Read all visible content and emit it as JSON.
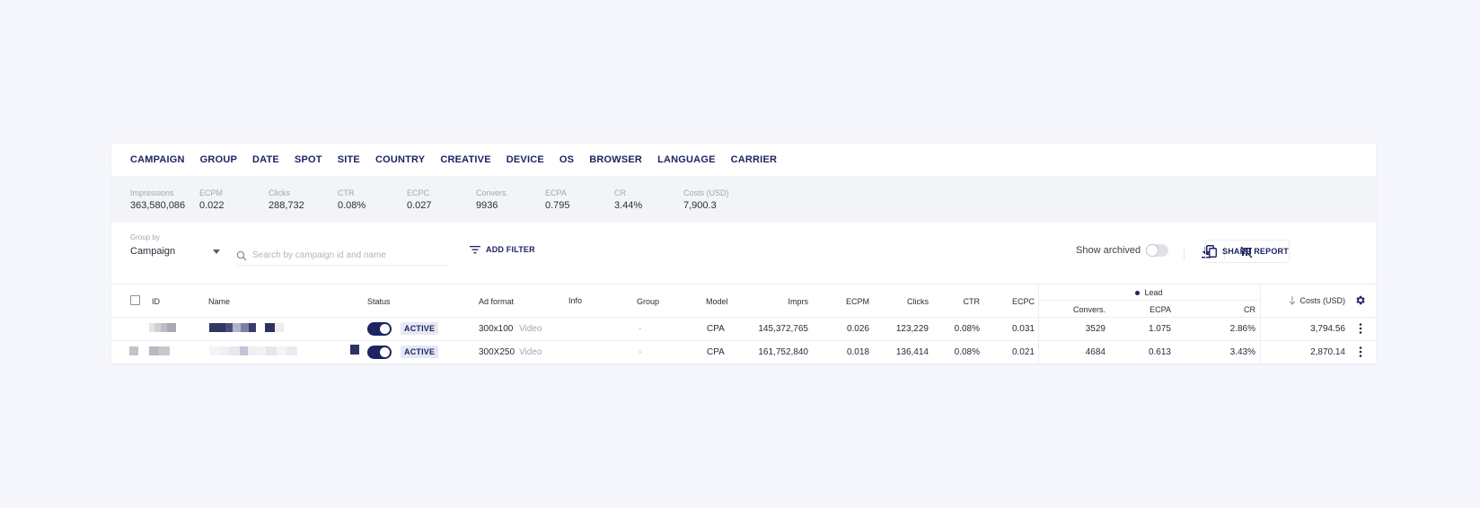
{
  "tabs": [
    "CAMPAIGN",
    "GROUP",
    "DATE",
    "SPOT",
    "SITE",
    "COUNTRY",
    "CREATIVE",
    "DEVICE",
    "OS",
    "BROWSER",
    "LANGUAGE",
    "CARRIER"
  ],
  "summary": [
    {
      "label": "Impressions",
      "value": "363,580,086"
    },
    {
      "label": "ECPM",
      "value": "0.022"
    },
    {
      "label": "Clicks",
      "value": "288,732"
    },
    {
      "label": "CTR",
      "value": "0.08%"
    },
    {
      "label": "ECPC",
      "value": "0.027"
    },
    {
      "label": "Convers.",
      "value": "9936"
    },
    {
      "label": "ECPA",
      "value": "0.795"
    },
    {
      "label": "CR",
      "value": "3.44%"
    },
    {
      "label": "Costs (USD)",
      "value": "7,900.3"
    }
  ],
  "controls": {
    "group_by_label": "Group by",
    "group_by_value": "Campaign",
    "search_placeholder": "Search by campaign id and name",
    "add_filter": "ADD FILTER",
    "show_archived": "Show archived",
    "share_report": "SHARE REPORT"
  },
  "table": {
    "headers": {
      "id": "ID",
      "name": "Name",
      "status": "Status",
      "ad_format": "Ad format",
      "info": "Info",
      "group": "Group",
      "model": "Model",
      "imprs": "Imprs",
      "ecpm": "ECPM",
      "clicks": "Clicks",
      "ctr": "CTR",
      "ecpc": "ECPC",
      "lead": "Lead",
      "convers": "Convers.",
      "ecpa": "ECPA",
      "cr": "CR",
      "costs": "Costs (USD)"
    },
    "rows": [
      {
        "status": "ACTIVE",
        "ad_format": "300x100",
        "ad_type": "Video",
        "group": "-",
        "model": "CPA",
        "imprs": "145,372,765",
        "ecpm": "0.026",
        "clicks": "123,229",
        "ctr": "0.08%",
        "ecpc": "0.031",
        "convers": "3529",
        "ecpa": "1.075",
        "cr": "2.86%",
        "costs": "3,794.56"
      },
      {
        "status": "ACTIVE",
        "ad_format": "300X250",
        "ad_type": "Video",
        "group": "-",
        "model": "CPA",
        "imprs": "161,752,840",
        "ecpm": "0.018",
        "clicks": "136,414",
        "ctr": "0.08%",
        "ecpc": "0.021",
        "convers": "4684",
        "ecpa": "0.613",
        "cr": "3.43%",
        "costs": "2,870.14"
      }
    ]
  },
  "colors": {
    "primary": "#1c2462",
    "page_bg": "#f6f7fc",
    "badge_bg": "#e6e8f4",
    "summary_bg": "#f3f4f6"
  }
}
